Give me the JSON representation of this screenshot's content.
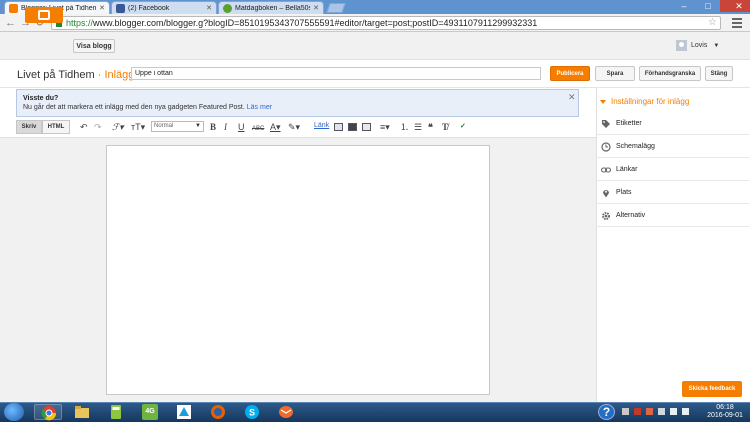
{
  "browser": {
    "tabs": [
      {
        "label": "Blogger: Livet på Tidhem",
        "active": true,
        "favicon": "blogger-favicon",
        "color": "#f57d00"
      },
      {
        "label": "(2) Facebook",
        "active": false,
        "favicon": "facebook-favicon",
        "color": "#3b5998"
      },
      {
        "label": "Matdagboken – Bella50s",
        "active": false,
        "favicon": "leaf-favicon",
        "color": "#5aa02c"
      }
    ],
    "url_scheme": "https://",
    "url_rest": "www.blogger.com/blogger.g?blogID=8510195343707555591#editor/target=post;postID=4931107911299932331"
  },
  "header": {
    "view_blog": "Visa blogg",
    "user_name": "Lovis"
  },
  "post": {
    "blog_name": "Livet på Tidhem",
    "separator": " · ",
    "crumb": "Inlägg",
    "title_value": "Uppe i ottan",
    "publish": "Publicera",
    "save": "Spara",
    "preview": "Förhandsgranska",
    "close": "Stäng"
  },
  "info": {
    "title": "Visste du?",
    "body": "Nu går det att markera ett inlägg med den nya gadgeten Featured Post.",
    "link": "Läs mer"
  },
  "toolbar": {
    "compose": "Skriv",
    "html": "HTML",
    "font_size_value": "Normal",
    "link": "Länk"
  },
  "sidebar": {
    "heading": "Inställningar för inlägg",
    "items": [
      {
        "label": "Etiketter",
        "icon": "tag-icon"
      },
      {
        "label": "Schemalägg",
        "icon": "clock-icon"
      },
      {
        "label": "Länkar",
        "icon": "link-icon"
      },
      {
        "label": "Plats",
        "icon": "pin-icon"
      },
      {
        "label": "Alternativ",
        "icon": "gear-icon"
      }
    ],
    "feedback": "Skicka feedback"
  },
  "taskbar": {
    "time": "06:18",
    "date": "2016-09-01",
    "apps": [
      "chrome-icon",
      "explorer-icon",
      "calculator-icon",
      "4g-icon",
      "app-icon",
      "firefox-icon",
      "skype-icon",
      "mail-icon"
    ],
    "fourg_label": "4G",
    "help": "?"
  }
}
